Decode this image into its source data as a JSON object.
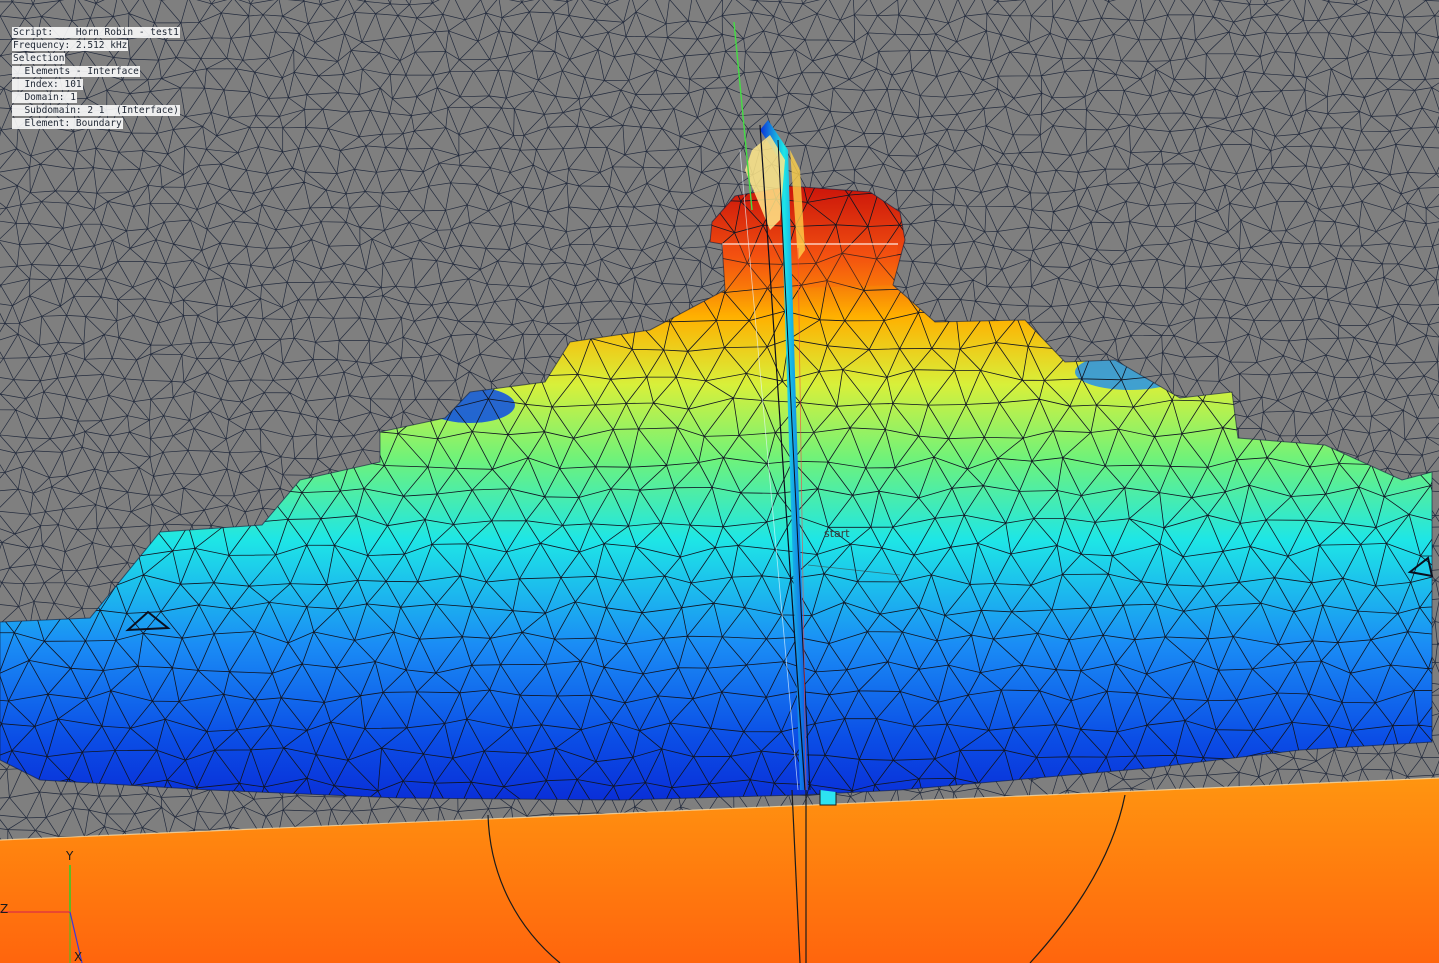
{
  "viewer": {
    "info_lines": [
      "Script:    Horn Robin - test1",
      "Frequency: 2.512 kHz",
      "Selection",
      "  Elements - Interface",
      "  Index: 101",
      "  Domain: 1",
      "  Subdomain: 2 1  (Interface)",
      "  Element: Boundary"
    ],
    "marker_label": "start",
    "axes": {
      "y": "Y",
      "z": "Z",
      "x": "X"
    }
  },
  "colors": {
    "background_mesh": "#7f7f7f",
    "mesh_lines": "#1a2236",
    "floor_orange": "#ff7a0d",
    "colormap_low": "#0a2fd8",
    "colormap_mid": "#6ff27a",
    "colormap_high": "#c9110a"
  }
}
